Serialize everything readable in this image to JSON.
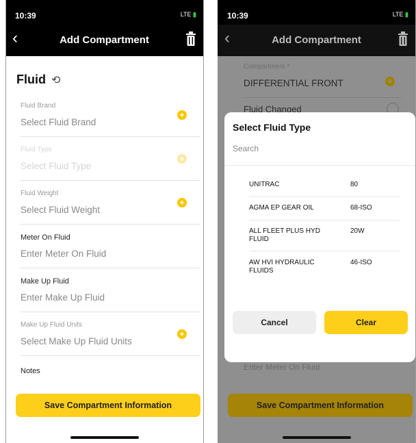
{
  "status": {
    "time": "10:39",
    "signal": "LTE"
  },
  "nav": {
    "title": "Add Compartment"
  },
  "section": {
    "title": "Fluid"
  },
  "fields": [
    {
      "label": "Fluid Brand",
      "value": "Select Fluid Brand"
    },
    {
      "label": "Fluid Type",
      "value": "Select Fluid Type"
    },
    {
      "label": "Fluid Weight",
      "value": "Select Fluid Weight"
    },
    {
      "label": "Meter On Fluid",
      "value": "Enter Meter On Fluid"
    },
    {
      "label": "Make Up Fluid",
      "value": "Enter Make Up Fluid"
    },
    {
      "label": "Make Up Fluid Units",
      "value": "Select Make Up Fluid Units"
    }
  ],
  "notes_label": "Notes",
  "save_label": "Save Compartment Information",
  "right": {
    "compartment_label": "Compartment *",
    "compartment_value": "DIFFERENTIAL FRONT",
    "fluid_changed_label": "Fluid Changed",
    "under_text": "Enter Meter On Fluid"
  },
  "modal": {
    "title": "Select Fluid Type",
    "search_placeholder": "Search",
    "options": [
      {
        "name": "UNITRAC",
        "code": "80"
      },
      {
        "name": "AGMA EP GEAR OIL",
        "code": "68-ISO"
      },
      {
        "name": "ALL FLEET PLUS HYD FLUID",
        "code": "20W"
      },
      {
        "name": "AW HVI HYDRAULIC FLUIDS",
        "code": "46-ISO"
      }
    ],
    "cancel_label": "Cancel",
    "clear_label": "Clear"
  },
  "colors": {
    "accent": "#fdcf1a",
    "header": "#000000"
  }
}
